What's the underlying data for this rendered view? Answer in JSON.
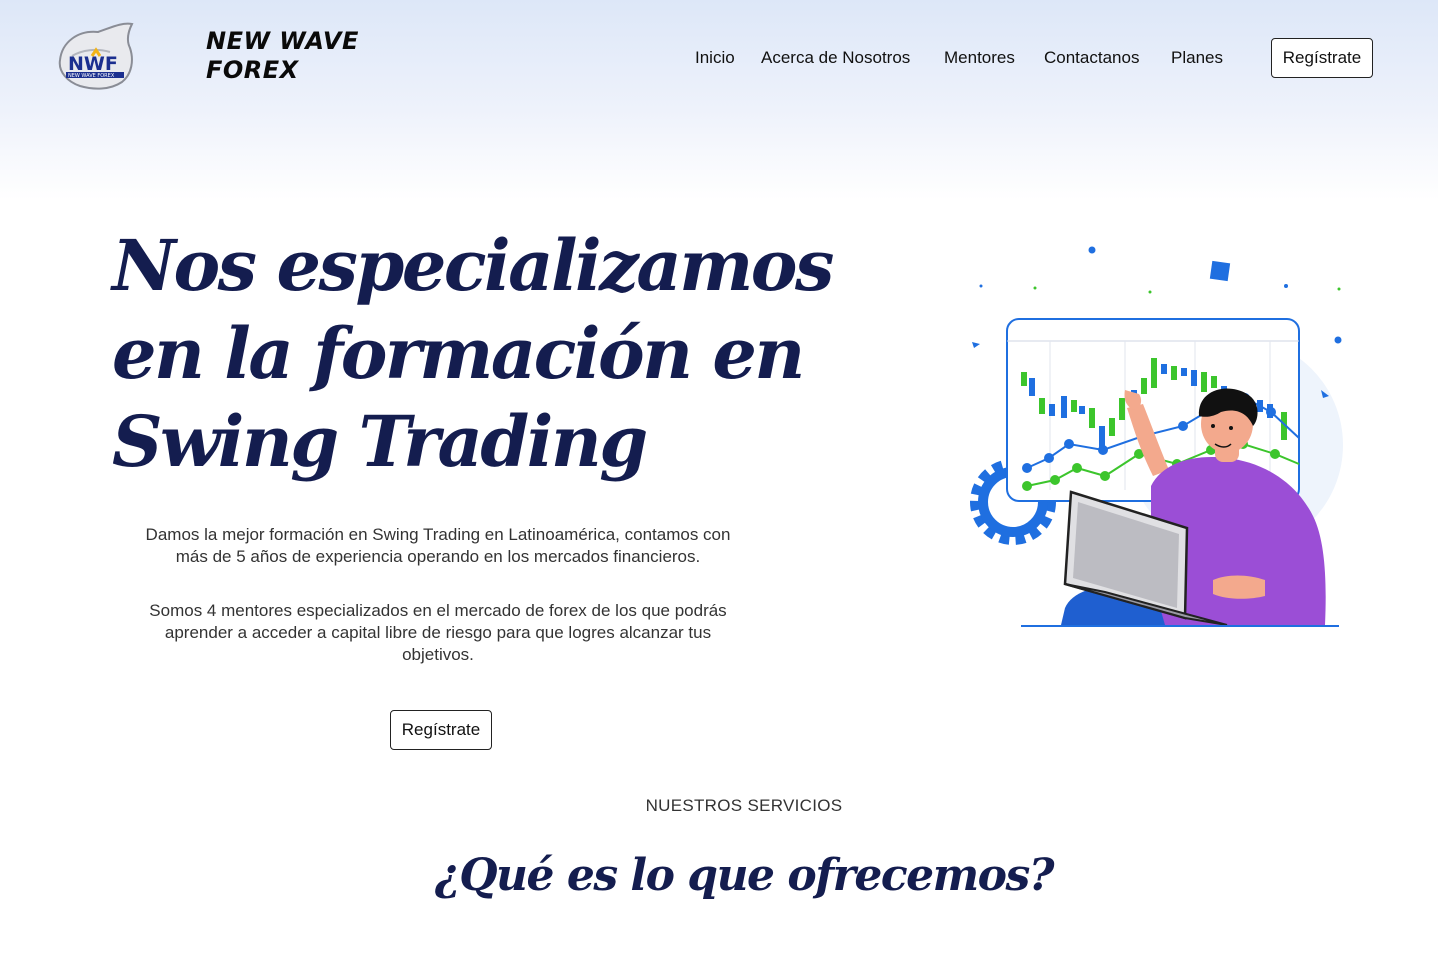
{
  "header": {
    "logo_text": "NWF",
    "logo_subtext": "NEW WAVE FOREX",
    "brand_line1": "NEW WAVE",
    "brand_line2": "FOREX",
    "nav": [
      {
        "label": "Inicio"
      },
      {
        "label": "Acerca de Nosotros"
      },
      {
        "label": "Mentores"
      },
      {
        "label": "Contactanos"
      },
      {
        "label": "Planes"
      }
    ],
    "cta_label": "Regístrate"
  },
  "hero": {
    "title_line1": "Nos especializamos",
    "title_line2": "en la formación en",
    "title_line3": "Swing Trading",
    "paragraph1": "Damos la mejor formación en Swing Trading en Latinoamérica, contamos con más de 5 años de experiencia operando en los mercados financieros.",
    "paragraph2": "Somos 4 mentores especializados en el mercado de forex de los que podrás aprender a acceder a capital libre de riesgo para que logres alcanzar tus objetivos.",
    "cta_label": "Regístrate",
    "illustration": "person-with-laptop-trading-chart-illustration"
  },
  "services": {
    "label": "NUESTROS SERVICIOS",
    "title": "¿Qué es lo que ofrecemos?"
  },
  "colors": {
    "heading": "#141d4f",
    "accent_blue": "#1f6fe0",
    "accent_green": "#3cc52c",
    "shirt_purple": "#9b4ed6"
  }
}
